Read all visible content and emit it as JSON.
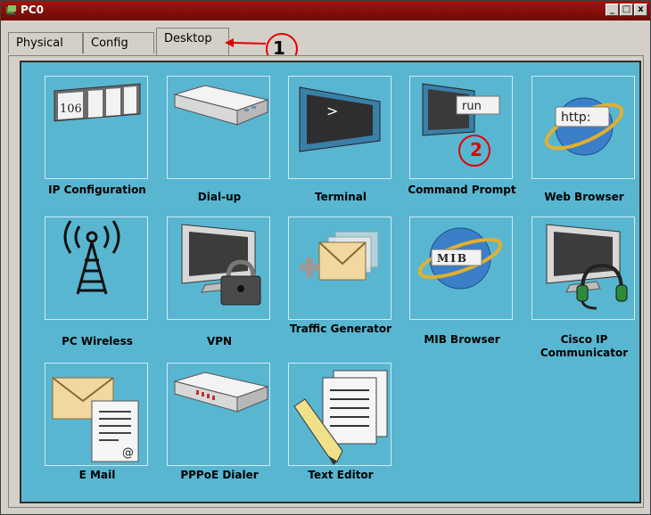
{
  "window": {
    "title": "PC0",
    "minimize": "_",
    "maximize": "□",
    "close": "x"
  },
  "tabs": [
    {
      "label": "Physical"
    },
    {
      "label": "Config"
    },
    {
      "label": "Desktop"
    }
  ],
  "annotations": {
    "one": "1",
    "two": "2"
  },
  "apps": [
    {
      "label": "IP Configuration",
      "icon": "ip-config-icon",
      "badge": "106"
    },
    {
      "label": "Dial-up",
      "icon": "modem-icon"
    },
    {
      "label": "Terminal",
      "icon": "terminal-icon",
      "prompt": ">"
    },
    {
      "label": "Command Prompt",
      "icon": "command-prompt-icon",
      "badge": "run"
    },
    {
      "label": "Web Browser",
      "icon": "web-browser-icon",
      "badge": "http:"
    },
    {
      "label": "PC Wireless",
      "icon": "wireless-antenna-icon"
    },
    {
      "label": "VPN",
      "icon": "vpn-lock-icon"
    },
    {
      "label": "Traffic Generator",
      "icon": "traffic-generator-icon"
    },
    {
      "label": "MIB Browser",
      "icon": "mib-browser-icon",
      "badge": "MIB"
    },
    {
      "label": "Cisco IP Communicator",
      "icon": "ip-communicator-icon"
    },
    {
      "label": "E Mail",
      "icon": "email-icon",
      "badge": "@"
    },
    {
      "label": "PPPoE Dialer",
      "icon": "pppoe-dialer-icon"
    },
    {
      "label": "Text Editor",
      "icon": "text-editor-icon"
    }
  ],
  "colors": {
    "desktop_bg": "#59b6d1",
    "titlebar": "#8b0e0c",
    "annotation": "#e00000"
  }
}
